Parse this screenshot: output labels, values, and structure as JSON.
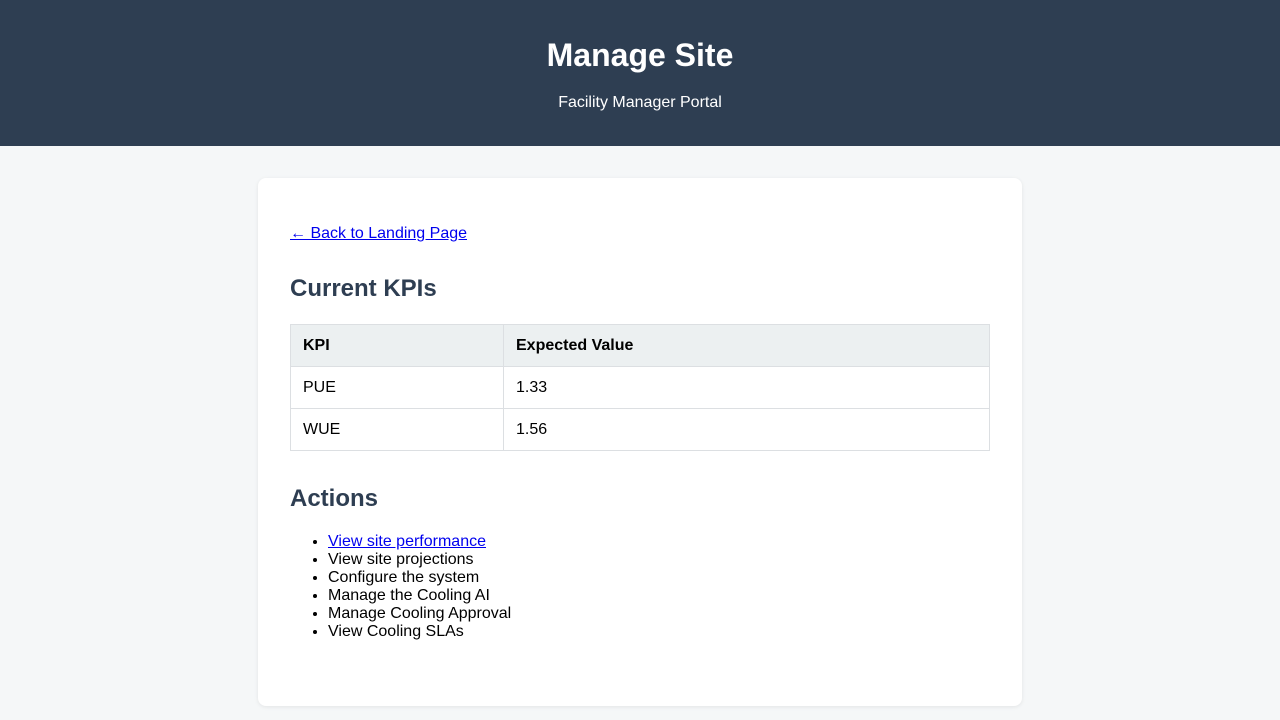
{
  "header": {
    "title": "Manage Site",
    "subtitle": "Facility Manager Portal"
  },
  "back_link": "← Back to Landing Page",
  "kpis": {
    "title": "Current KPIs",
    "columns": [
      "KPI",
      "Expected Value"
    ],
    "rows": [
      [
        "PUE",
        "1.33"
      ],
      [
        "WUE",
        "1.56"
      ]
    ]
  },
  "actions": {
    "title": "Actions",
    "items": [
      "View site performance",
      "View site projections",
      "Configure the system",
      "Manage the Cooling AI",
      "Manage Cooling Approval",
      "View Cooling SLAs"
    ]
  },
  "colors": {
    "header_bg": "#2e3e52",
    "link": "#0000ee",
    "page_bg": "#f5f7f8"
  }
}
